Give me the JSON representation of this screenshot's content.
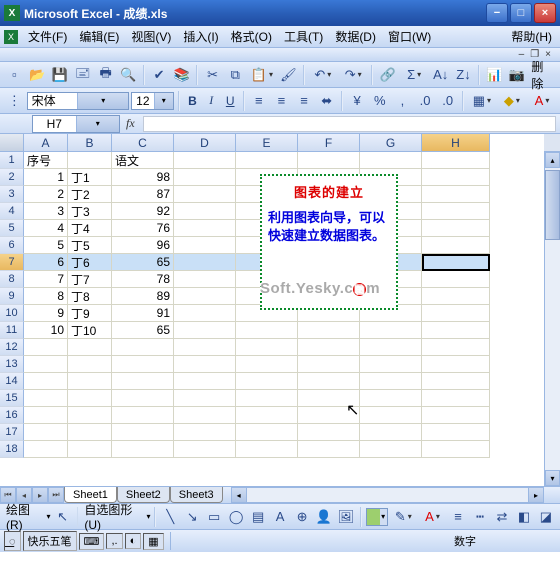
{
  "title": "Microsoft Excel - 成绩.xls",
  "menus": {
    "file": "文件(F)",
    "edit": "编辑(E)",
    "view": "视图(V)",
    "insert": "插入(I)",
    "format": "格式(O)",
    "tools": "工具(T)",
    "data": "数据(D)",
    "window": "窗口(W)",
    "help": "帮助(H)"
  },
  "toolbar2_delete": "删除",
  "format": {
    "font": "宋体",
    "size": "12"
  },
  "namebox": "H7",
  "columns": [
    "A",
    "B",
    "C",
    "D",
    "E",
    "F",
    "G",
    "H"
  ],
  "row_numbers": [
    "1",
    "2",
    "3",
    "4",
    "5",
    "6",
    "7",
    "8",
    "9",
    "10",
    "11",
    "12",
    "13",
    "14",
    "15",
    "16",
    "17",
    "18"
  ],
  "headers": {
    "A": "序号",
    "C": "语文"
  },
  "rows": [
    {
      "a": "1",
      "b": "丁1",
      "c": "98"
    },
    {
      "a": "2",
      "b": "丁2",
      "c": "87"
    },
    {
      "a": "3",
      "b": "丁3",
      "c": "92"
    },
    {
      "a": "4",
      "b": "丁4",
      "c": "76"
    },
    {
      "a": "5",
      "b": "丁5",
      "c": "96"
    },
    {
      "a": "6",
      "b": "丁6",
      "c": "65"
    },
    {
      "a": "7",
      "b": "丁7",
      "c": "78"
    },
    {
      "a": "8",
      "b": "丁8",
      "c": "89"
    },
    {
      "a": "9",
      "b": "丁9",
      "c": "91"
    },
    {
      "a": "10",
      "b": "丁10",
      "c": "65"
    }
  ],
  "selected_row_index": 6,
  "textbox": {
    "line1": "图表的建立",
    "line2": "利用图表向导，可以快速建立数据图表。"
  },
  "watermark": {
    "t1": "Soft.Yesky.c",
    "t2": "m",
    "dot": "图"
  },
  "sheets": {
    "s1": "Sheet1",
    "s2": "Sheet2",
    "s3": "Sheet3"
  },
  "drawbar": {
    "draw": "绘图(R)",
    "autoshape": "自选图形(U)"
  },
  "status": {
    "ime1": "꯭꯭",
    "ime2": "快乐五笔",
    "numlock": "数字"
  }
}
